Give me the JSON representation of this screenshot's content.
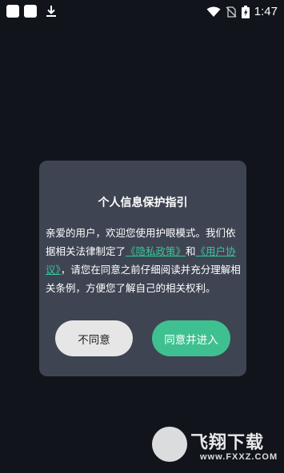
{
  "status_bar": {
    "time": "1:47",
    "battery_level": "charging"
  },
  "dialog": {
    "title": "个人信息保护指引",
    "body_part1": "亲爱的用户，欢迎您使用护眼模式。我们依据相关法律制定了",
    "privacy_link": "《隐私政策》",
    "conjunction": "和",
    "agreement_link": "《用户协议》",
    "body_part2": "，请您在同意之前仔细阅读并充分理解相关条例，方便您了解自己的相关权利。",
    "decline_label": "不同意",
    "accept_label": "同意并进入"
  },
  "watermark": {
    "main_text": "飞翔下载",
    "url": "www.FXXZ.COM"
  },
  "colors": {
    "background": "#11141b",
    "dialog_bg": "#3f4453",
    "accent": "#3fc090",
    "link": "#35c79b"
  }
}
